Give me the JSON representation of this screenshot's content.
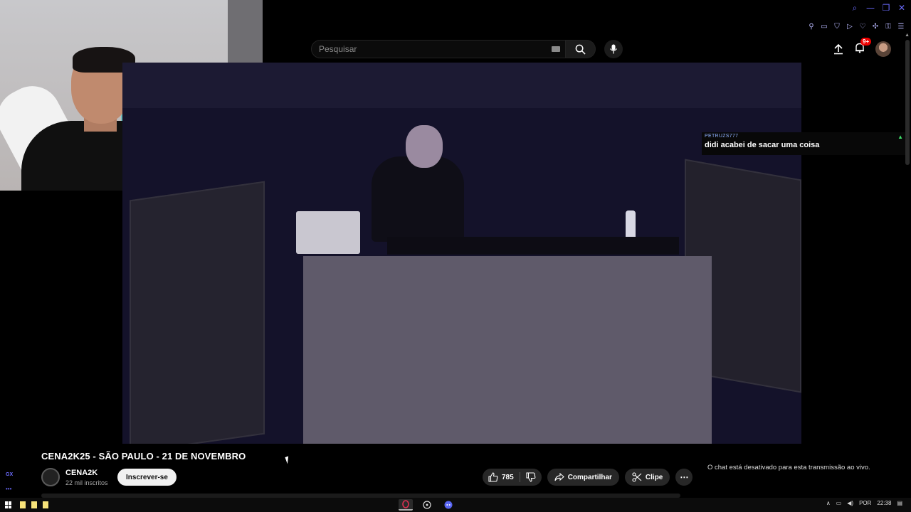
{
  "search": {
    "placeholder": "Pesquisar"
  },
  "header": {
    "notifications_badge": "9+"
  },
  "video": {
    "title": "CENA2K25 - SÃO PAULO - 21 DE NOVEMBRO",
    "channel": {
      "name": "CENA2K",
      "subscribers": "22 mil inscritos"
    },
    "subscribe_label": "Inscrever-se",
    "likes": "785",
    "share_label": "Compartilhar",
    "clip_label": "Clipe"
  },
  "chat_overlay": {
    "username": "PETRUZS777",
    "message": "didi acabei de sacar uma coisa"
  },
  "chat_status": "O chat está desativado para esta transmissão ao vivo.",
  "sidebar": {
    "gx_label": "GX",
    "more": "•••"
  },
  "taskbar": {
    "language": "POR",
    "time": "22:38"
  },
  "colors": {
    "accent": "#6b6bff",
    "badge": "#ee0000",
    "chat_username": "#8fb0ff"
  }
}
